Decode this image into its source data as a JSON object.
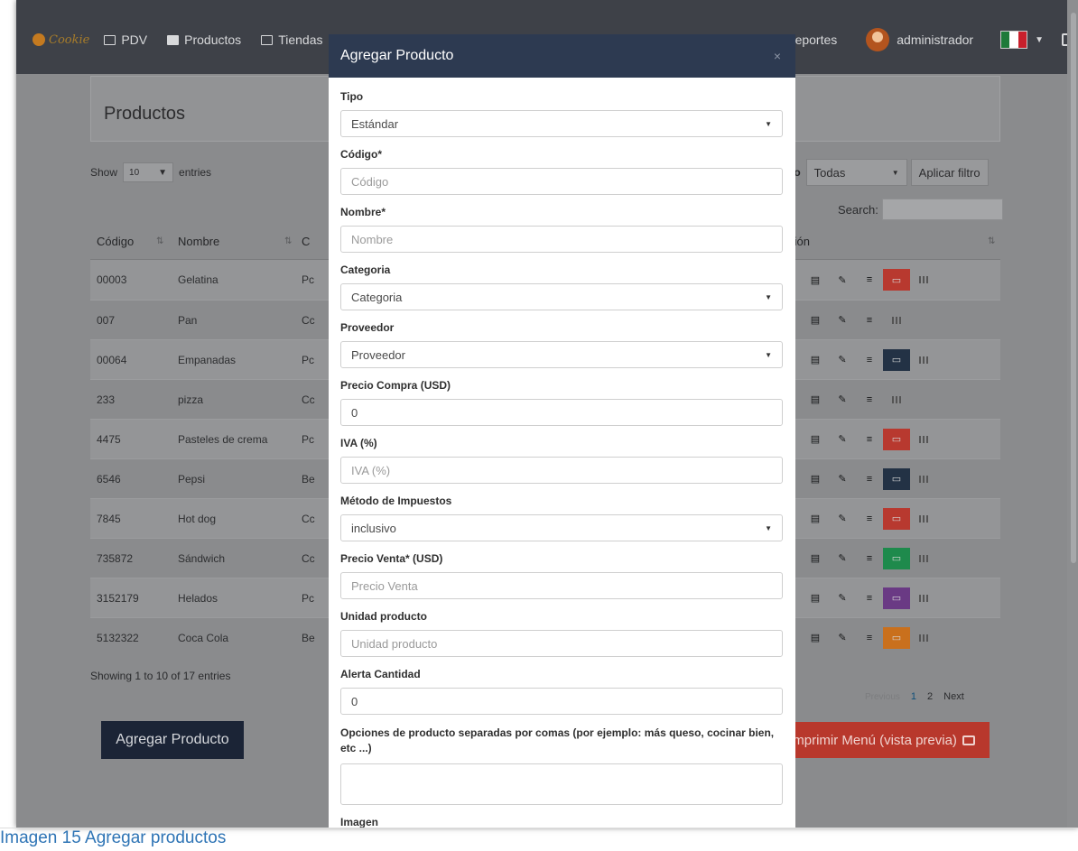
{
  "navbar": {
    "logo_text": "Cookie",
    "items": [
      {
        "label": "PDV",
        "icon": "monitor-icon"
      },
      {
        "label": "Productos",
        "icon": "box-icon"
      },
      {
        "label": "Tiendas",
        "icon": "store-icon"
      }
    ],
    "reportes_label": "Reportes",
    "user_label": "administrador",
    "flag_colors": [
      "#1e7a3a",
      "#ffffff",
      "#c8202c"
    ]
  },
  "page": {
    "title": "Productos",
    "show_label": "Show",
    "entries_value": "10",
    "entries_label": "entries",
    "filter_label": "ducto",
    "filter_value": "Todas",
    "filter_button": "Aplicar filtro",
    "search_label": "Search:",
    "footer_info": "Showing 1 to 10 of 17 entries",
    "pager": {
      "prev": "Previous",
      "pages": [
        "1",
        "2"
      ],
      "next": "Next"
    },
    "add_button": "Agregar Producto",
    "print_button": "Imprimir Menú (vista previa)"
  },
  "table": {
    "headers": {
      "codigo": "Código",
      "nombre": "Nombre",
      "categoria": "C",
      "accion": "Acción"
    },
    "rows": [
      {
        "codigo": "00003",
        "nombre": "Gelatina",
        "cat": "Pc",
        "img_color": "#b8392f"
      },
      {
        "codigo": "007",
        "nombre": "Pan",
        "cat": "Cc",
        "img_color": ""
      },
      {
        "codigo": "00064",
        "nombre": "Empanadas",
        "cat": "Pc",
        "img_color": "#233245"
      },
      {
        "codigo": "233",
        "nombre": "pizza",
        "cat": "Cc",
        "img_color": ""
      },
      {
        "codigo": "4475",
        "nombre": "Pasteles de crema",
        "cat": "Pc",
        "img_color": "#b8392f"
      },
      {
        "codigo": "6546",
        "nombre": "Pepsi",
        "cat": "Be",
        "img_color": "#233245"
      },
      {
        "codigo": "7845",
        "nombre": "Hot dog",
        "cat": "Cc",
        "img_color": "#b8392f"
      },
      {
        "codigo": "735872",
        "nombre": "Sándwich",
        "cat": "Cc",
        "img_color": "#1e8a4c"
      },
      {
        "codigo": "3152179",
        "nombre": "Helados",
        "cat": "Pc",
        "img_color": "#6a3a84"
      },
      {
        "codigo": "5132322",
        "nombre": "Coca Cola",
        "cat": "Be",
        "img_color": "#c9701d"
      }
    ]
  },
  "modal": {
    "title": "Agregar Producto",
    "close": "×",
    "fields": [
      {
        "label": "Tipo",
        "value": "Estándar",
        "kind": "select"
      },
      {
        "label": "Código*",
        "placeholder": "Código",
        "kind": "input"
      },
      {
        "label": "Nombre*",
        "placeholder": "Nombre",
        "kind": "input"
      },
      {
        "label": "Categoria",
        "value": "Categoria",
        "kind": "select"
      },
      {
        "label": "Proveedor",
        "value": "Proveedor",
        "kind": "select"
      },
      {
        "label": "Precio Compra (USD)",
        "value": "0",
        "kind": "input"
      },
      {
        "label": "IVA (%)",
        "placeholder": "IVA (%)",
        "kind": "input"
      },
      {
        "label": "Método de Impuestos",
        "value": "inclusivo",
        "kind": "select"
      },
      {
        "label": "Precio Venta* (USD)",
        "placeholder": "Precio Venta",
        "kind": "input"
      },
      {
        "label": "Unidad producto",
        "placeholder": "Unidad producto",
        "kind": "input"
      },
      {
        "label": "Alerta Cantidad",
        "value": "0",
        "kind": "input"
      },
      {
        "label": "Opciones de producto separadas por comas (por ejemplo: más queso, cocinar bien, etc ...)",
        "kind": "textarea"
      },
      {
        "label": "Imagen",
        "kind": "label"
      }
    ]
  },
  "caption": "Imagen 15 Agregar productos"
}
